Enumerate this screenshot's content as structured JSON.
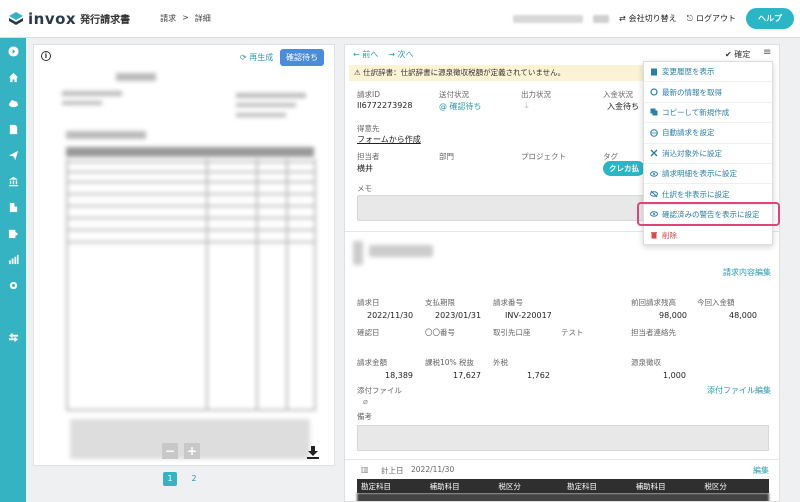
{
  "header": {
    "brand": "invox",
    "product": "発行請求書",
    "breadcrumb": [
      "請求",
      ">",
      "詳細"
    ],
    "switch_company": "会社切り替え",
    "logout": "ログアウト",
    "help": "ヘルプ"
  },
  "sidebar": {
    "icons": [
      "arrow-circle-icon",
      "home-icon",
      "cloud-upload-icon",
      "document-icon",
      "send-icon",
      "bank-icon",
      "building-icon",
      "export-icon",
      "chart-icon",
      "gear-icon",
      "transfer-icon"
    ]
  },
  "preview": {
    "regenerate": "再生成",
    "status": "確認待ち",
    "pages": [
      "1",
      "2"
    ],
    "minus": "−",
    "plus": "+"
  },
  "detail": {
    "prev": "← 前へ",
    "next": "→ 次へ",
    "confirm": "✔ 確定",
    "warning": "⚠ 仕訳辞書：仕訳辞書に源泉徴収税額が定義されていません。",
    "fields": {
      "invoice_id_label": "請求ID",
      "invoice_id": "Il6772273928",
      "send_status_label": "送付状況",
      "send_status": "確認待ち",
      "output_status_label": "出力状況",
      "payment_status_label": "入金状況",
      "payment_status": "入金待ち",
      "recipient_label": "得意先",
      "recipient": "フォームから作成",
      "assignee_label": "担当者",
      "assignee": "横井",
      "department_label": "部門",
      "project_label": "プロジェクト",
      "tag_label": "タグ",
      "tag": "クレカ払",
      "memo_label": "メモ"
    },
    "edit_invoice": "請求内容編集",
    "summary": {
      "billing_date_label": "請求日",
      "billing_date": "2022/11/30",
      "due_label": "支払期限",
      "due": "2023/01/31",
      "invoice_no_label": "請求番号",
      "invoice_no": "INV-220017",
      "prev_balance_label": "前回請求残高",
      "prev_balance": "98,000",
      "this_payment_label": "今回入金額",
      "this_payment": "48,000",
      "confirm_date_label": "確認日",
      "number_label": "〇〇番号",
      "account_label": "取引先口座",
      "account_value": "テスト",
      "contact_label": "担当者連絡先",
      "amount_label": "請求金額",
      "amount": "18,389",
      "tax10_label": "課税10% 税抜",
      "tax10": "17,627",
      "external_tax_label": "外税",
      "external_tax": "1,762",
      "withholding_label": "源泉徴収",
      "withholding": "1,000",
      "attachment_label": "添付ファイル",
      "attachment_edit": "添付ファイル編集",
      "remarks_label": "備考"
    },
    "accrual_label": "計上日",
    "accrual_date": "2022/11/30",
    "edit": "編集",
    "table_headers": [
      "勘定科目",
      "補助科目",
      "税区分",
      "勘定科目",
      "補助科目",
      "税区分"
    ]
  },
  "menu": {
    "items": [
      "変更履歴を表示",
      "最新の情報を取得",
      "コピーして新規作成",
      "自動請求を設定",
      "消込対象外に設定",
      "請求明細を表示に設定",
      "仕訳を非表示に設定",
      "確認済みの警告を表示に設定",
      "削除"
    ]
  },
  "colors": {
    "accent": "#35b3c2",
    "link": "#2a9bb0",
    "status_blue": "#4a8cd8",
    "warning_bg": "#fcf3d4",
    "highlight": "#e0457a",
    "danger": "#d84a4a"
  }
}
